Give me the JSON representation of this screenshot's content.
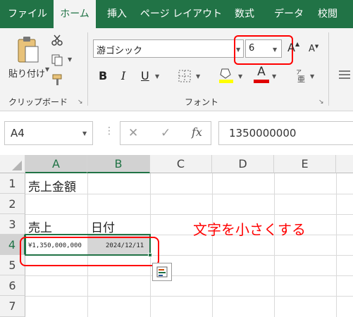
{
  "ribbon_tabs": [
    {
      "label": "ファイル"
    },
    {
      "label": "ホーム",
      "active": true
    },
    {
      "label": "挿入"
    },
    {
      "label": "ページ レイアウト"
    },
    {
      "label": "数式"
    },
    {
      "label": "データ"
    },
    {
      "label": "校閲"
    }
  ],
  "clipboard": {
    "paste_label": "貼り付け",
    "group_label": "クリップボード"
  },
  "font": {
    "font_name": "游ゴシック",
    "font_size": "6",
    "group_label": "フォント",
    "bold": "B",
    "italic": "I",
    "underline": "U",
    "font_color_letter": "A",
    "grow_label": "A",
    "shrink_label": "A"
  },
  "formula_bar": {
    "name_box": "A4",
    "cancel": "✕",
    "enter": "✓",
    "fx": "fx",
    "value": "1350000000"
  },
  "grid": {
    "columns": [
      "A",
      "B",
      "C",
      "D",
      "E"
    ],
    "rows": [
      "1",
      "2",
      "3",
      "4",
      "5",
      "6",
      "7"
    ],
    "selected_row": "4",
    "cells": {
      "A1": "売上金額",
      "A3": "売上",
      "B3": "日付",
      "A4": "¥1,350,000,000",
      "B4": "2024/12/11"
    }
  },
  "annotation": {
    "text": "文字を小さくする",
    "color": "#ff0000"
  },
  "colors": {
    "brand": "#217346",
    "highlight": "#ff0000"
  }
}
